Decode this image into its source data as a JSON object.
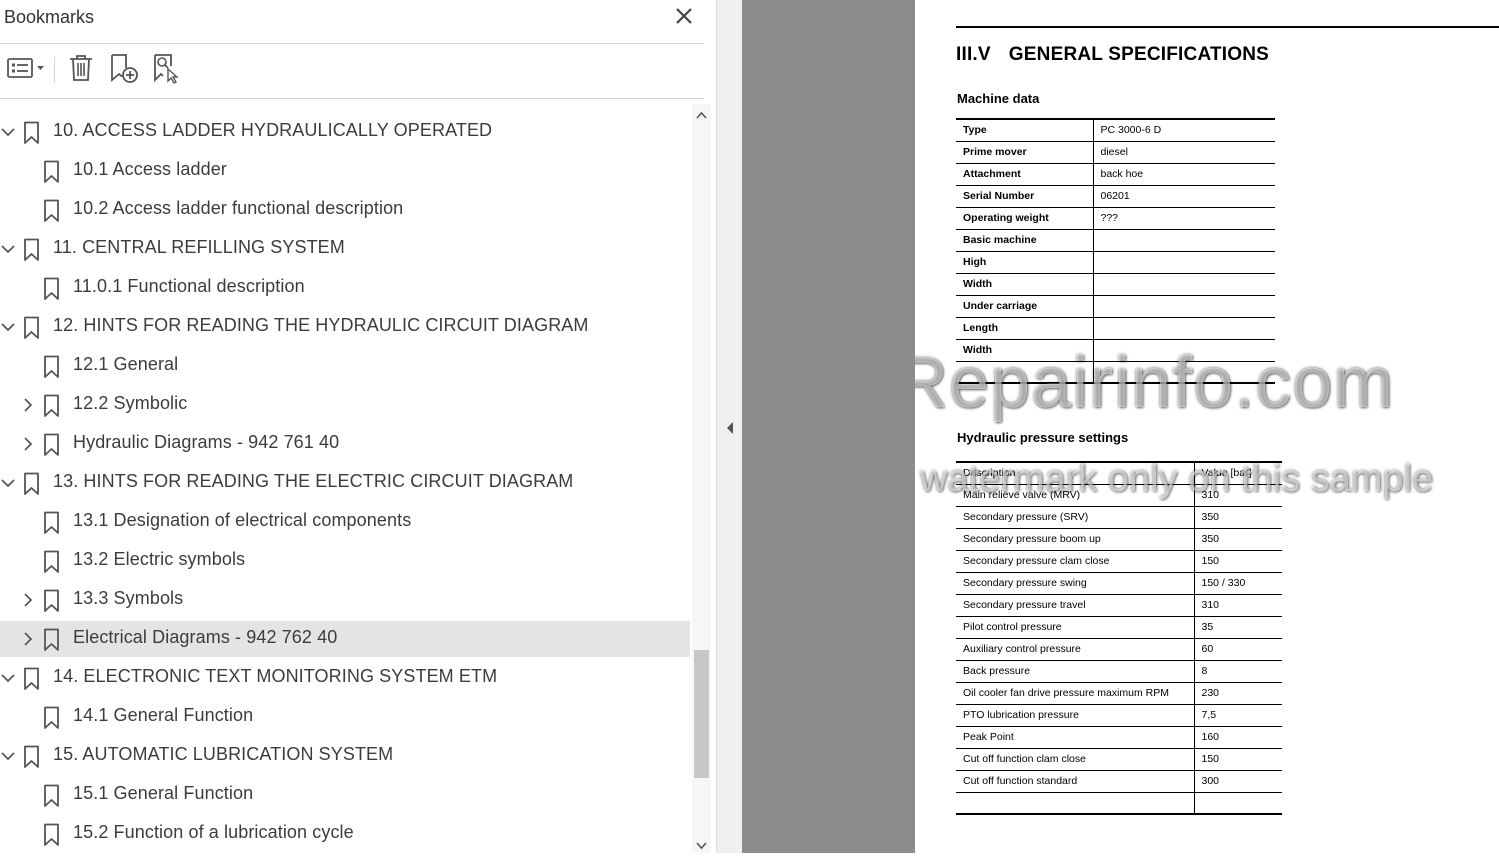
{
  "bookmarks_panel": {
    "title": "Bookmarks",
    "toolbar": {
      "options_icon": "list-options-icon",
      "delete_icon": "trash-icon",
      "new_bookmark_icon": "bookmark-add-icon",
      "find_bookmark_icon": "bookmark-find-icon"
    },
    "items": [
      {
        "label": "10. ACCESS LADDER HYDRAULICALLY OPERATED",
        "level": 0,
        "state": "expanded",
        "selected": false
      },
      {
        "label": "10.1 Access ladder",
        "level": 1,
        "state": "none",
        "selected": false
      },
      {
        "label": "10.2 Access ladder functional description",
        "level": 1,
        "state": "none",
        "selected": false
      },
      {
        "label": "11. CENTRAL REFILLING SYSTEM",
        "level": 0,
        "state": "expanded",
        "selected": false
      },
      {
        "label": "11.0.1 Functional description",
        "level": 1,
        "state": "none",
        "selected": false
      },
      {
        "label": "12. HINTS FOR READING THE HYDRAULIC CIRCUIT DIAGRAM",
        "level": 0,
        "state": "expanded",
        "selected": false
      },
      {
        "label": "12.1 General",
        "level": 1,
        "state": "none",
        "selected": false
      },
      {
        "label": "12.2 Symbolic",
        "level": 1,
        "state": "collapsed",
        "selected": false
      },
      {
        "label": "Hydraulic Diagrams - 942 761 40",
        "level": 1,
        "state": "collapsed",
        "selected": false
      },
      {
        "label": "13. HINTS FOR READING THE ELECTRIC CIRCUIT DIAGRAM",
        "level": 0,
        "state": "expanded",
        "selected": false
      },
      {
        "label": "13.1 Designation of electrical components",
        "level": 1,
        "state": "none",
        "selected": false
      },
      {
        "label": "13.2 Electric symbols",
        "level": 1,
        "state": "none",
        "selected": false
      },
      {
        "label": "13.3 Symbols",
        "level": 1,
        "state": "collapsed",
        "selected": false
      },
      {
        "label": "Electrical Diagrams - 942 762 40",
        "level": 1,
        "state": "collapsed",
        "selected": true
      },
      {
        "label": "14. ELECTRONIC TEXT MONITORING SYSTEM ETM",
        "level": 0,
        "state": "expanded",
        "selected": false
      },
      {
        "label": "14.1 General Function",
        "level": 1,
        "state": "none",
        "selected": false
      },
      {
        "label": "15. AUTOMATIC LUBRICATION SYSTEM",
        "level": 0,
        "state": "expanded",
        "selected": false
      },
      {
        "label": "15.1 General Function",
        "level": 1,
        "state": "none",
        "selected": false
      },
      {
        "label": "15.2 Function of a lubrication cycle",
        "level": 1,
        "state": "none",
        "selected": false
      }
    ]
  },
  "document": {
    "section_number": "III.V",
    "section_title": "GENERAL SPECIFICATIONS",
    "machine_data": {
      "heading": "Machine data",
      "rows": [
        [
          "Type",
          "PC 3000-6 D"
        ],
        [
          "Prime mover",
          "diesel"
        ],
        [
          "Attachment",
          "back hoe"
        ],
        [
          "Serial Number",
          "06201"
        ],
        [
          "Operating weight",
          "???"
        ],
        [
          "Basic machine",
          ""
        ],
        [
          "High",
          ""
        ],
        [
          "Width",
          ""
        ],
        [
          "Under carriage",
          ""
        ],
        [
          "Length",
          ""
        ],
        [
          "Width",
          ""
        ],
        [
          "",
          ""
        ]
      ]
    },
    "hydraulic": {
      "heading": "Hydraulic pressure settings",
      "columns": [
        "Description",
        "Value [bar]"
      ],
      "rows": [
        [
          "Main relieve valve (MRV)",
          "310"
        ],
        [
          "Secondary pressure (SRV)",
          "350"
        ],
        [
          "Secondary pressure boom up",
          "350"
        ],
        [
          "Secondary pressure clam close",
          "150"
        ],
        [
          "Secondary pressure swing",
          "150 / 330"
        ],
        [
          "Secondary pressure travel",
          "310"
        ],
        [
          "Pilot control pressure",
          "35"
        ],
        [
          "Auxiliary control pressure",
          "60"
        ],
        [
          "Back pressure",
          "8"
        ],
        [
          "Oil cooler fan drive pressure maximum RPM",
          "230"
        ],
        [
          "PTO lubrication pressure",
          "7,5"
        ],
        [
          "Peak Point",
          "160"
        ],
        [
          "Cut off function clam close",
          "150"
        ],
        [
          "Cut off function standard",
          "300"
        ],
        [
          "",
          ""
        ]
      ]
    },
    "watermark_main": "eRepairinfo.com",
    "watermark_sub": "watermark only on this sample"
  },
  "colors": {
    "selected_row": "#e4e4e4",
    "gray_area": "#8c8c8c",
    "icon": "#555555"
  }
}
